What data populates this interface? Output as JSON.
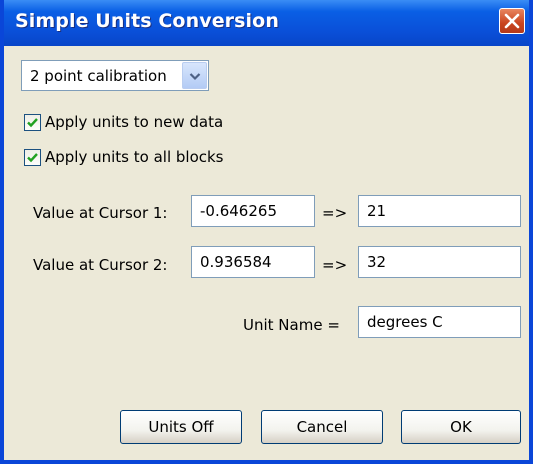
{
  "window": {
    "title": "Simple Units Conversion",
    "close_icon": "close-icon"
  },
  "mode_select": {
    "value": "2 point calibration",
    "arrow_icon": "chevron-down-icon"
  },
  "options": {
    "apply_new_data": {
      "label": "Apply units to new data",
      "checked": true
    },
    "apply_all_blocks": {
      "label": "Apply units to all blocks",
      "checked": true
    }
  },
  "cursor1": {
    "label": "Value at Cursor 1:",
    "value": "-0.646265",
    "arrow": "=>",
    "target": "21"
  },
  "cursor2": {
    "label": "Value at Cursor 2:",
    "value": "0.936584",
    "arrow": "=>",
    "target": "32"
  },
  "unit": {
    "label": "Unit Name =",
    "value": "degrees C"
  },
  "buttons": {
    "units_off": "Units Off",
    "cancel": "Cancel",
    "ok": "OK"
  },
  "colors": {
    "titlebar": "#0a4fd8",
    "dialog_bg": "#ece9d8",
    "field_border": "#7f9db9",
    "check_mark": "#21a121"
  }
}
